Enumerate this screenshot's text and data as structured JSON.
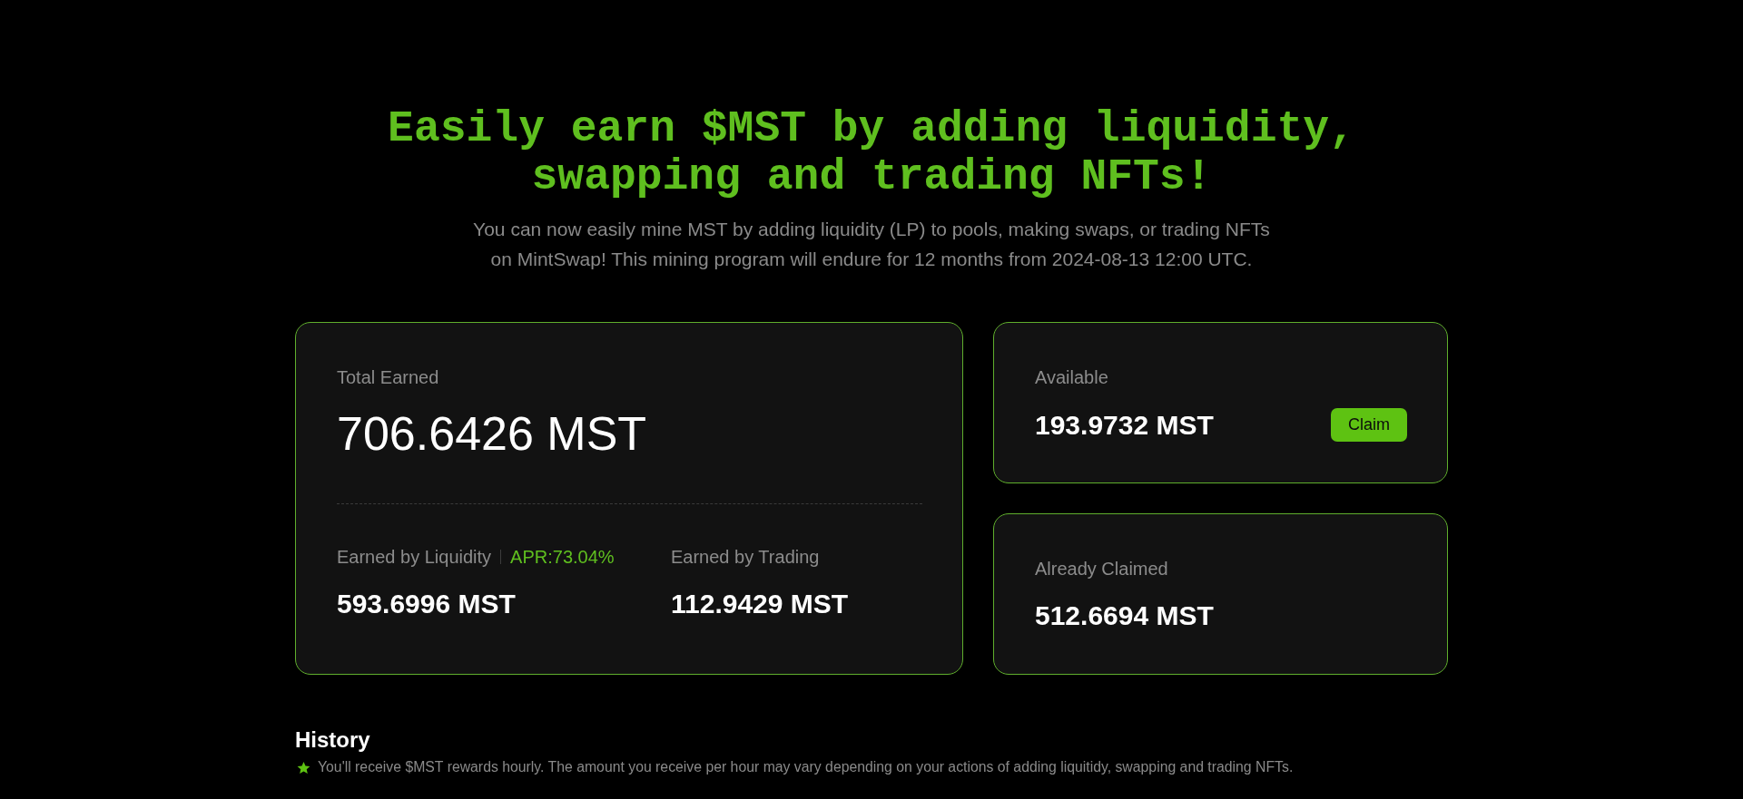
{
  "hero": {
    "title": "Easily earn $MST by adding liquidity, swapping and trading NFTs!",
    "description": "You can now easily mine MST by adding liquidity (LP) to pools, making swaps, or trading NFTs on MintSwap! This mining program will endure for 12 months from 2024-08-13 12:00 UTC."
  },
  "total_earned": {
    "label": "Total Earned",
    "value": "706.6426 MST",
    "breakdown": [
      {
        "label": "Earned by Liquidity",
        "apr": "APR:73.04%",
        "value": "593.6996 MST"
      },
      {
        "label": "Earned by Trading",
        "value": "112.9429 MST"
      }
    ]
  },
  "available": {
    "label": "Available",
    "value": "193.9732 MST",
    "button": "Claim"
  },
  "already_claimed": {
    "label": "Already Claimed",
    "value": "512.6694 MST"
  },
  "history": {
    "title": "History",
    "note": "You'll receive $MST rewards hourly. The amount you receive per hour may vary depending on your actions of adding liquitidy, swapping and trading NFTs."
  }
}
